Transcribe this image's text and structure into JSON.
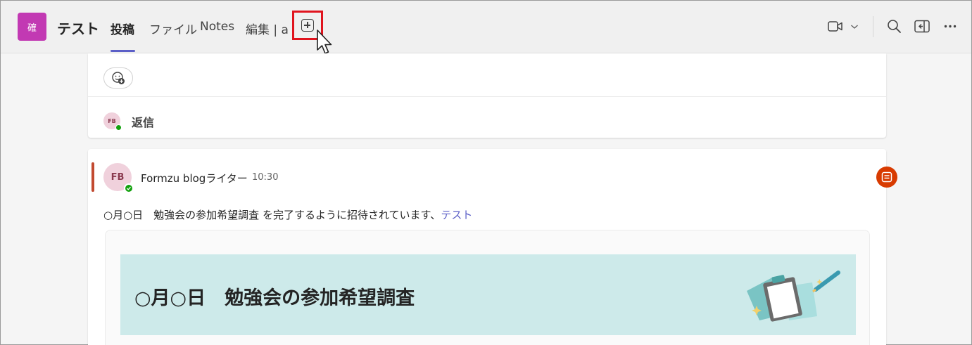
{
  "colors": {
    "team_avatar": "#c239b3",
    "tab_underline": "#5b5fc7",
    "highlight_box": "#e0141e",
    "link": "#5b5fc7",
    "app_badge": "#d83b01",
    "banner": "#cdeaea"
  },
  "header": {
    "team_avatar_text": "確",
    "channel_name": "テスト",
    "tabs": [
      {
        "label": "投稿",
        "active": true
      },
      {
        "label": "ファイル",
        "active": false
      },
      {
        "label": "Notes",
        "active": false
      },
      {
        "label": "編集 | a",
        "active": false
      }
    ],
    "add_tab_icon": "plus-square-icon",
    "right_icons": [
      "video-camera-icon",
      "chevron-down-icon",
      "search-icon",
      "open-panel-icon",
      "more-icon"
    ]
  },
  "thread_top": {
    "reaction_icon": "add-reaction-icon",
    "reply_avatar_initials": "FB",
    "reply_label": "返信"
  },
  "post": {
    "avatar_initials": "FB",
    "author": "Formzu blogライター",
    "timestamp": "10:30",
    "message_prefix": "○月○日　勉強会の参加希望調査 を完了するように招待されています、",
    "message_link": "テスト",
    "app_badge_icon": "forms-icon",
    "form_card": {
      "title": "○月○日　勉強会の参加希望調査",
      "illustration": "clipboard-icon"
    }
  }
}
